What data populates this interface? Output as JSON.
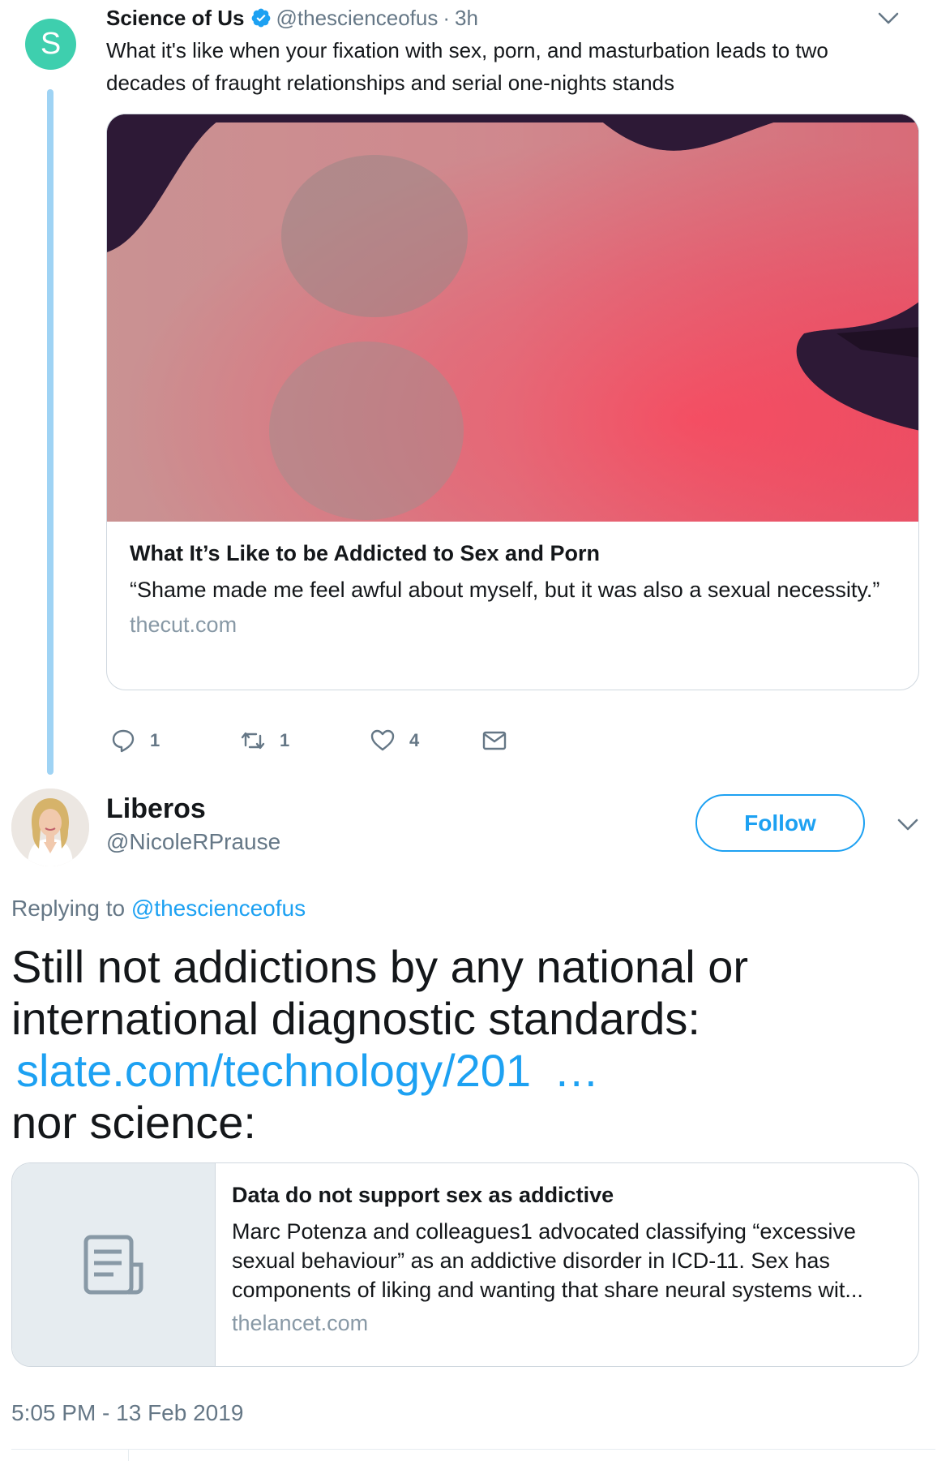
{
  "parent_tweet": {
    "avatar_letter": "S",
    "avatar_color": "#3ecfae",
    "author": "Science of Us",
    "handle": "@thescienceofus",
    "separator": "·",
    "time": "3h",
    "text": "What it's like when your fixation with sex, porn, and masturbation leads to two decades of fraught relationships and serial one-nights stands",
    "card": {
      "title": "What It’s Like to be Addicted to Sex and Porn",
      "description": "“Shame made me feel awful about myself, but it was also a sexual necessity.”",
      "domain": "thecut.com"
    },
    "actions": {
      "reply_count": "1",
      "retweet_count": "1",
      "like_count": "4"
    }
  },
  "reply_tweet": {
    "name": "Liberos",
    "handle": "@NicoleRPrause",
    "follow_label": "Follow",
    "replying_prefix": "Replying to",
    "replying_handle": "@thescienceofus",
    "text_line1": "Still not addictions by any national or international diagnostic standards:",
    "link_text": "slate.com/technology/201",
    "link_ellipsis": "…",
    "text_line2": "nor science:",
    "card": {
      "title": "Data do not support sex as addictive",
      "description": "Marc Potenza and colleagues1 advocated classifying “excessive sexual behaviour” as an addictive disorder in ICD-11. Sex has components of liking and wanting that share neural systems wit...",
      "domain": "thelancet.com"
    },
    "timestamp": "5:05 PM - 13 Feb 2019"
  },
  "colors": {
    "accent": "#1da1f2",
    "thread_line": "#9fd3f4",
    "secondary_text": "#657786",
    "verified": "#1da1f2"
  },
  "icons": {
    "verified": "verified-badge-icon",
    "caret": "chevron-down-icon",
    "reply": "reply-icon",
    "retweet": "retweet-icon",
    "like": "heart-icon",
    "dm": "envelope-icon",
    "article": "document-icon"
  }
}
